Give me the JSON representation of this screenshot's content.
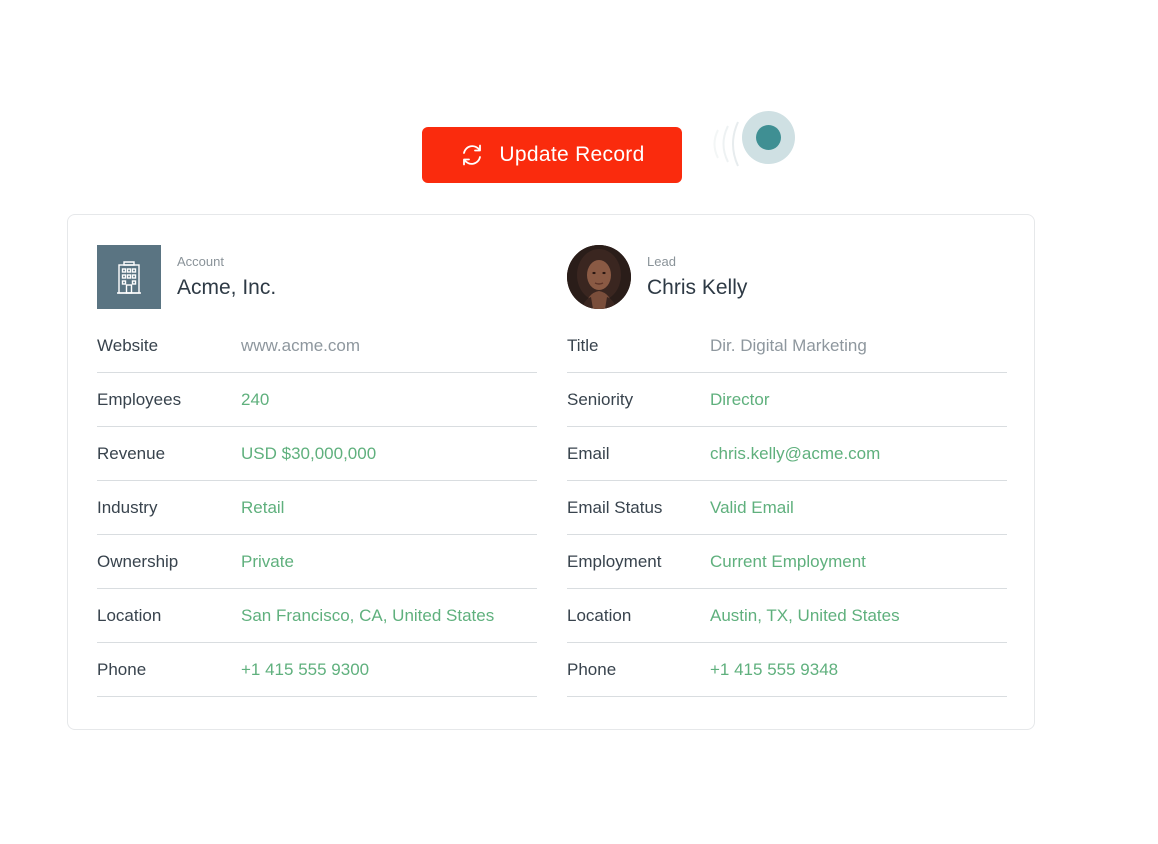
{
  "button": {
    "label": "Update Record",
    "color": "#fa2b0d"
  },
  "account": {
    "kicker": "Account",
    "name": "Acme, Inc.",
    "icon": "building-icon",
    "fields": [
      {
        "label": "Website",
        "value": "www.acme.com",
        "muted": true
      },
      {
        "label": "Employees",
        "value": "240"
      },
      {
        "label": "Revenue",
        "value": "USD $30,000,000"
      },
      {
        "label": "Industry",
        "value": "Retail"
      },
      {
        "label": "Ownership",
        "value": "Private"
      },
      {
        "label": "Location",
        "value": "San Francisco, CA, United States"
      },
      {
        "label": "Phone",
        "value": "+1 415 555 9300"
      }
    ]
  },
  "lead": {
    "kicker": "Lead",
    "name": "Chris Kelly",
    "fields": [
      {
        "label": "Title",
        "value": "Dir. Digital Marketing",
        "muted": true
      },
      {
        "label": "Seniority",
        "value": "Director"
      },
      {
        "label": "Email",
        "value": "chris.kelly@acme.com"
      },
      {
        "label": "Email Status",
        "value": "Valid Email"
      },
      {
        "label": "Employment",
        "value": "Current Employment"
      },
      {
        "label": "Location",
        "value": "Austin, TX, United States"
      },
      {
        "label": "Phone",
        "value": "+1 415 555 9348"
      }
    ]
  },
  "colors": {
    "accent_green": "#5fb07d",
    "muted_text": "#8e979e",
    "label_text": "#38434d",
    "account_icon_bg": "#5a7482",
    "cursor_dot": "#3f8f93"
  }
}
